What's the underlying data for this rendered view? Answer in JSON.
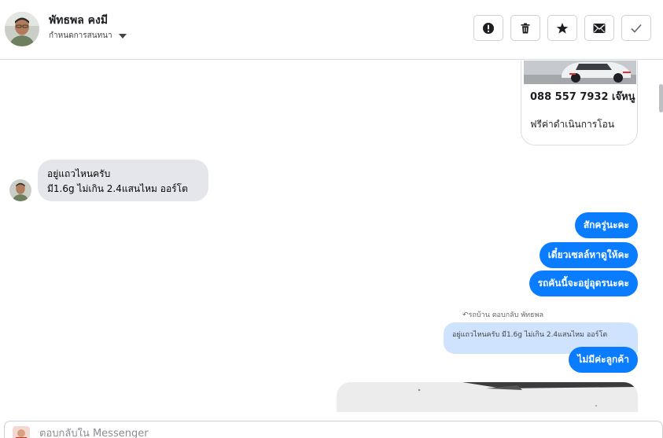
{
  "header": {
    "contact_name": "พัทธพล คงมี",
    "conversation_settings": "กำหนดการสนทนา",
    "toolbar": [
      {
        "name": "spam-button",
        "icon": "exclamation-icon"
      },
      {
        "name": "delete-button",
        "icon": "trash-icon"
      },
      {
        "name": "star-button",
        "icon": "star-icon"
      },
      {
        "name": "mark-unread-button",
        "icon": "envelope-icon"
      },
      {
        "name": "mark-done-button",
        "icon": "checkmark-icon"
      }
    ]
  },
  "card": {
    "phone": "088 557 7932 เจ๊หนู",
    "subtitle": "ฟรีค่าดำเนินการโอน"
  },
  "incoming": {
    "line1": "อยู่แถวไหนครับ",
    "line2": "มี1.6g ไม่เกิน 2.4แสนไหม ออร์โต"
  },
  "outgoing": [
    "สักครู่นะคะ",
    "เดี๋ยวเซลล์หาดูให้คะ",
    "รถคันนี้จะอยู่อุดรนะคะ"
  ],
  "reply": {
    "meta": "รถบ้าน ตอบกลับ พัทธพล",
    "quote": "อยู่แถวไหนครับ มี1.6g ไม่เกิน 2.4แสนไหม ออร์โต",
    "message": "ไม่มีค่ะลูกค้า"
  },
  "composer": {
    "placeholder": "ตอบกลับใน Messenger"
  },
  "colors": {
    "outgoing_bubble": "#0a7cff",
    "incoming_bubble": "#e4e6eb",
    "quote_bubble": "#cfe3ff"
  }
}
